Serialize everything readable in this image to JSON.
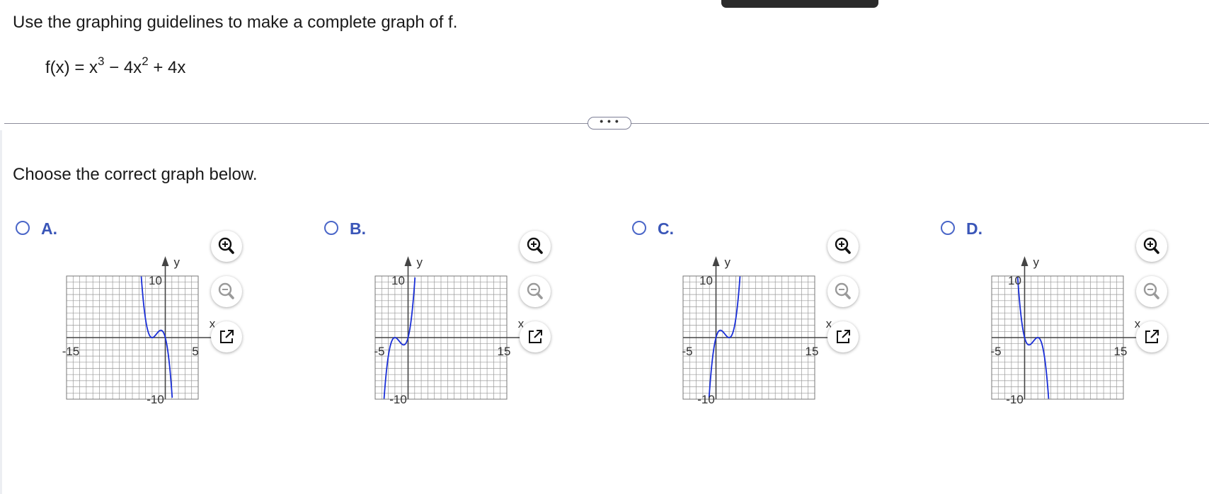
{
  "question": {
    "instruction": "Use the graphing guidelines to make a complete graph of f.",
    "function_lhs": "f(x) = x",
    "exp1": "3",
    "minus_term": " − 4x",
    "exp2": "2",
    "plus_term": " + 4x"
  },
  "more_button": "• • •",
  "prompt": "Choose the correct graph below.",
  "options": [
    {
      "letter": "A.",
      "xmin": -15,
      "xmax": 5,
      "ymin": -10,
      "ymax": 10,
      "xmin_label": "-15",
      "xmax_label": "5",
      "ymax_label": "10",
      "ymin_label": "-10",
      "x_axis": "x",
      "y_axis": "y",
      "curve": "f(-x)"
    },
    {
      "letter": "B.",
      "xmin": -5,
      "xmax": 15,
      "ymin": -10,
      "ymax": 10,
      "xmin_label": "-5",
      "xmax_label": "15",
      "ymax_label": "10",
      "ymin_label": "-10",
      "x_axis": "x",
      "y_axis": "y",
      "curve": "x^3+4x^2+4x"
    },
    {
      "letter": "C.",
      "xmin": -5,
      "xmax": 15,
      "ymin": -10,
      "ymax": 10,
      "xmin_label": "-5",
      "xmax_label": "15",
      "ymax_label": "10",
      "ymin_label": "-10",
      "x_axis": "x",
      "y_axis": "y",
      "curve": "x^3-4x^2+4x"
    },
    {
      "letter": "D.",
      "xmin": -5,
      "xmax": 15,
      "ymin": -10,
      "ymax": 10,
      "xmin_label": "-5",
      "xmax_label": "15",
      "ymax_label": "10",
      "ymin_label": "-10",
      "x_axis": "x",
      "y_axis": "y",
      "curve": "-(x^3-4x^2+4x)"
    }
  ],
  "tools": [
    "zoom-in-icon",
    "zoom-out-icon",
    "open-external-icon"
  ],
  "colors": {
    "accent": "#3a56b8",
    "curve": "#1a2fd8",
    "grid": "#9a9a9a",
    "axis": "#444444"
  }
}
